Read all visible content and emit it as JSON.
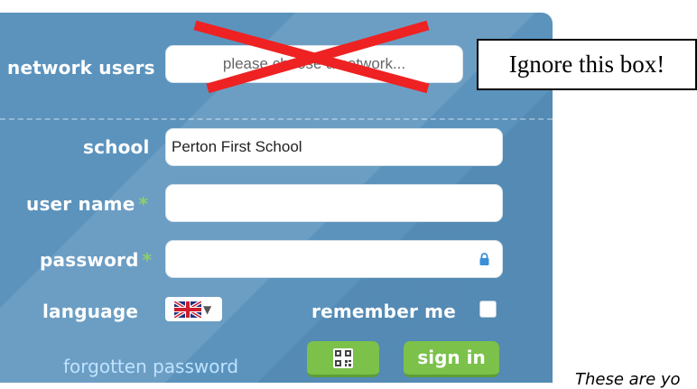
{
  "login": {
    "network_users_label": "network users",
    "network_select_placeholder": "please choose a network...",
    "school_label": "school",
    "school_value": "Perton First School",
    "username_label": "user name",
    "username_value": "",
    "password_label": "password",
    "password_value": "",
    "required_marker": "*",
    "language_label": "language",
    "language_flag": "uk-flag",
    "remember_me_label": "remember me",
    "remember_me_checked": false,
    "forgotten_password_link": "forgotten password",
    "qr_button_icon": "qr-code-icon",
    "sign_in_button": "sign in"
  },
  "annotation": {
    "ignore_box_text": "Ignore this box!",
    "footnote_text": "These are yo"
  },
  "colors": {
    "panel_bg": "#5b93bd",
    "green_button": "#7bc14a",
    "required_star": "#8ecf6a",
    "link": "#bfe3ff",
    "cross": "#ee2222"
  }
}
